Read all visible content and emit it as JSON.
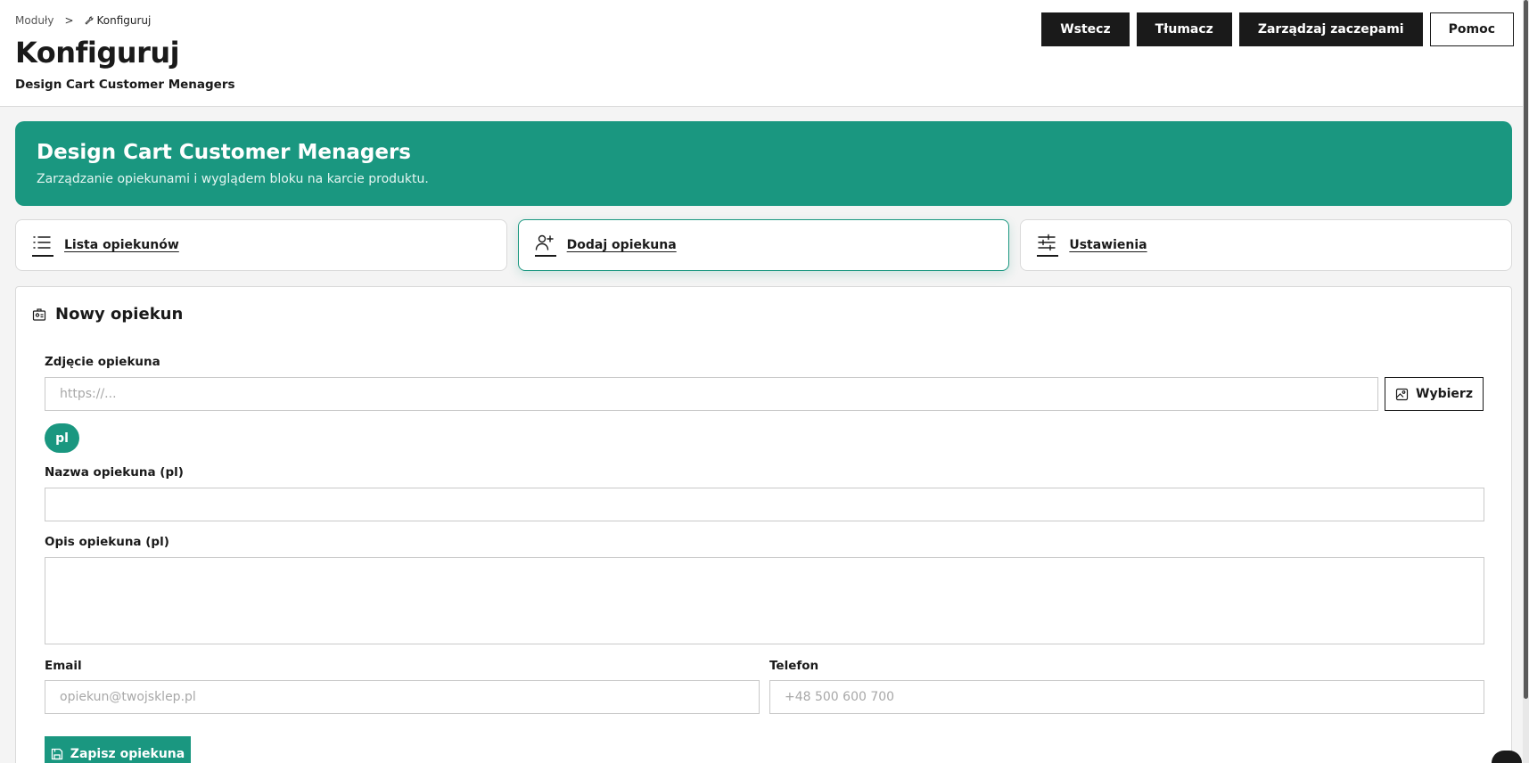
{
  "breadcrumb": {
    "parent": "Moduły",
    "separator": ">",
    "current": "Konfiguruj"
  },
  "header": {
    "title": "Konfiguruj",
    "subtitle": "Design Cart Customer Menagers"
  },
  "toolbar": {
    "back": "Wstecz",
    "translate": "Tłumacz",
    "hooks": "Zarządzaj zaczepami",
    "help": "Pomoc"
  },
  "banner": {
    "title": "Design Cart Customer Menagers",
    "description": "Zarządzanie opiekunami i wyglądem bloku na karcie produktu."
  },
  "tabs": [
    {
      "label": "Lista opiekunów",
      "icon": "list-icon",
      "active": false
    },
    {
      "label": "Dodaj opiekuna",
      "icon": "user-plus-icon",
      "active": true
    },
    {
      "label": "Ustawienia",
      "icon": "sliders-icon",
      "active": false
    }
  ],
  "form": {
    "title": "Nowy opiekun",
    "photo_label": "Zdjęcie opiekuna",
    "photo_placeholder": "https://...",
    "photo_value": "",
    "choose_label": "Wybierz",
    "lang": "pl",
    "name_label": "Nazwa opiekuna (pl)",
    "name_value": "",
    "desc_label": "Opis opiekuna (pl)",
    "desc_value": "",
    "email_label": "Email",
    "email_placeholder": "opiekun@twojsklep.pl",
    "phone_label": "Telefon",
    "phone_placeholder": "+48 500 600 700",
    "save_label": "Zapisz opiekuna"
  },
  "colors": {
    "accent": "#1a9780",
    "dark": "#1a1a1a"
  }
}
